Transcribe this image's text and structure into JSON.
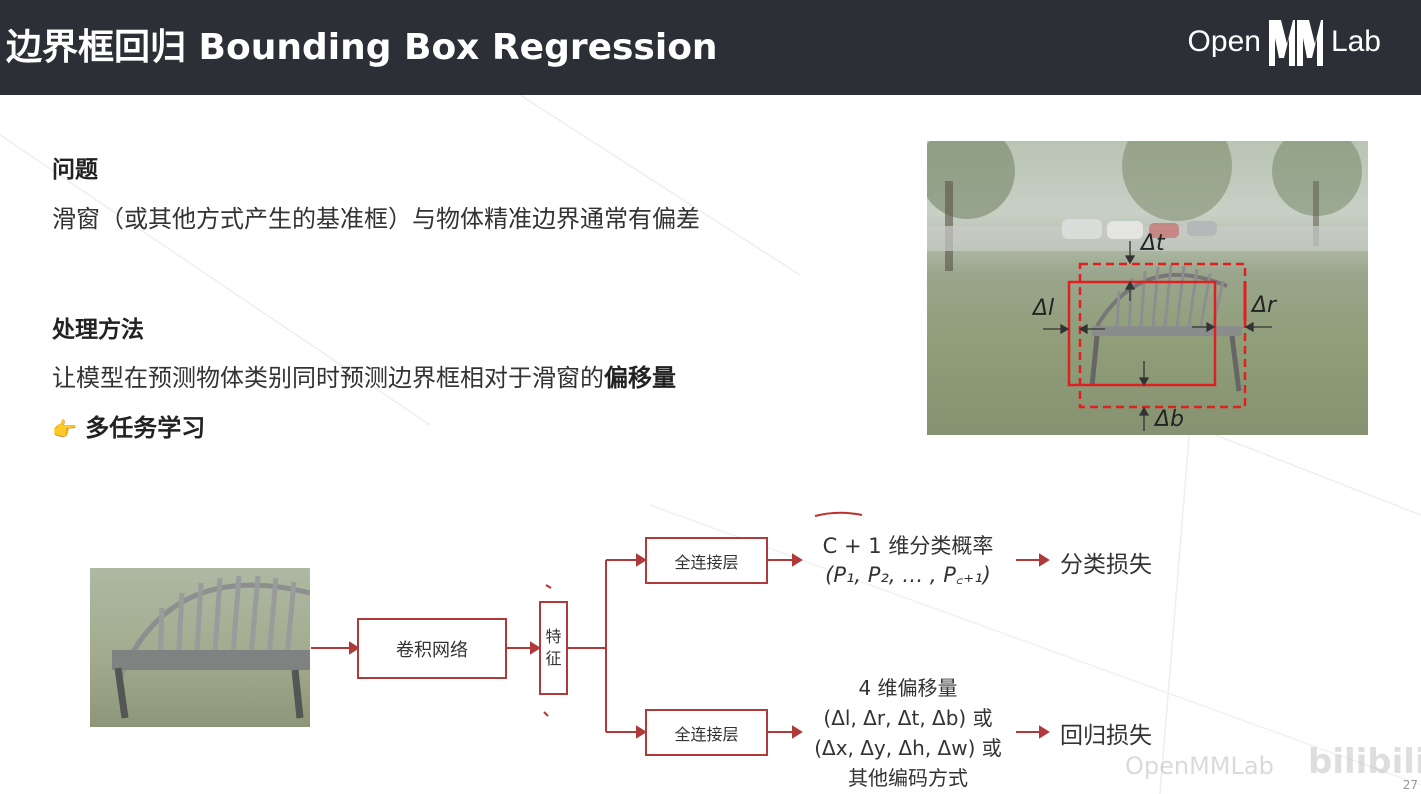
{
  "header": {
    "title": "边界框回归 Bounding Box Regression",
    "logo_left": "Open",
    "logo_right": "Lab"
  },
  "problem": {
    "heading": "问题",
    "text": "滑窗（或其他方式产生的基准框）与物体精准边界通常有偏差"
  },
  "method": {
    "heading": "处理方法",
    "text_prefix": "让模型在预测物体类别同时预测边界框相对于滑窗的",
    "text_bold": "偏移量",
    "bullet_icon": "👉",
    "bullet_text": "多任务学习"
  },
  "photo_labels": {
    "dt": "Δt",
    "dl": "Δl",
    "dr": "Δr",
    "db": "Δb"
  },
  "diagram": {
    "cnn_label": "卷积网络",
    "feature_label_1": "特",
    "feature_label_2": "征",
    "fc_top": "全连接层",
    "fc_bottom": "全连接层",
    "cls_line1": "C + 1 维分类概率",
    "cls_line2": "(P₁, P₂, … , P꜀₊₁)",
    "reg_line1": "4 维偏移量",
    "reg_line2": "(Δl, Δr, Δt, Δb) 或",
    "reg_line3": "(Δx, Δy, Δh, Δw) 或",
    "reg_line4": "其他编码方式",
    "cls_loss": "分类损失",
    "reg_loss": "回归损失"
  },
  "watermark": "OpenMMLab",
  "watermark2": "bilibili",
  "page_number": "27",
  "colors": {
    "header_bg": "#2c2f36",
    "accent_red": "#b03a3a",
    "box_red": "#e02020"
  }
}
